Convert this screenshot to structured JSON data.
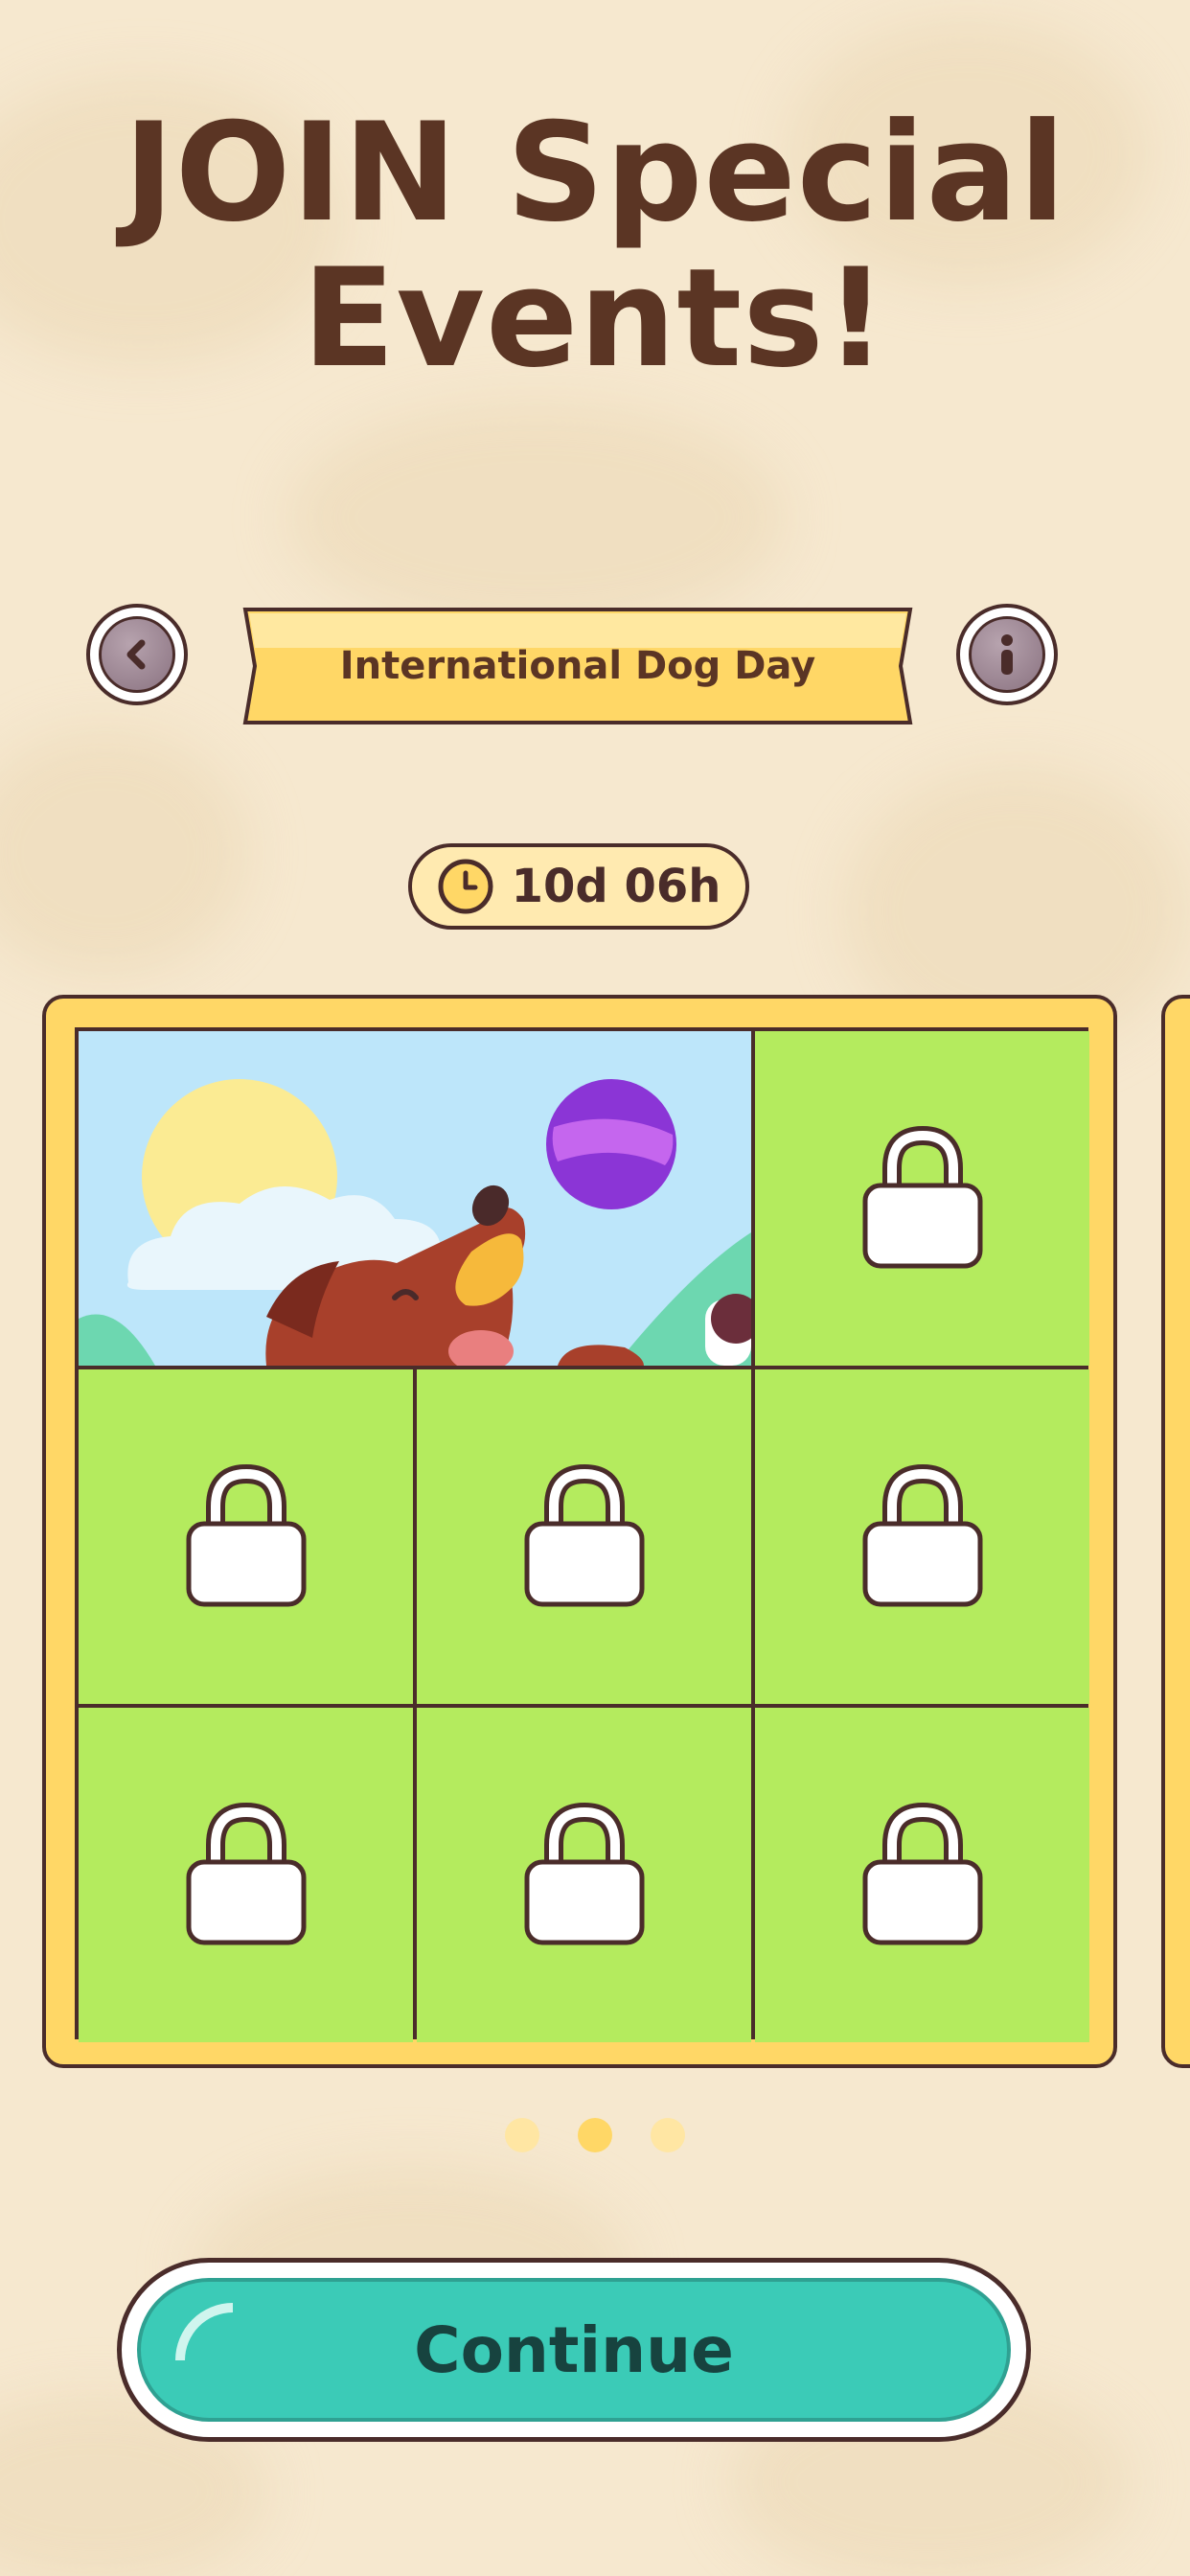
{
  "header": {
    "title_line1": "JOIN Special",
    "title_line2": "Events!"
  },
  "event_nav": {
    "prev_icon": "chevron-left-icon",
    "info_icon": "info-icon",
    "event_name": "International Dog Day"
  },
  "timer": {
    "icon": "clock-icon",
    "remaining": "10d 06h"
  },
  "puzzle": {
    "rows": 3,
    "cols": 3,
    "unlocked_image": "dog-with-ball-illustration",
    "locked_icon": "lock-icon",
    "locked_count": 7
  },
  "pager": {
    "pages": 3,
    "active": 1
  },
  "footer": {
    "continue_label": "Continue"
  },
  "colors": {
    "background": "#F6E8CF",
    "title": "#5B3524",
    "banner": "#FFD766",
    "board_frame": "#FFD766",
    "locked_tile": "#B4EB5E",
    "button": "#3BCBB7"
  }
}
